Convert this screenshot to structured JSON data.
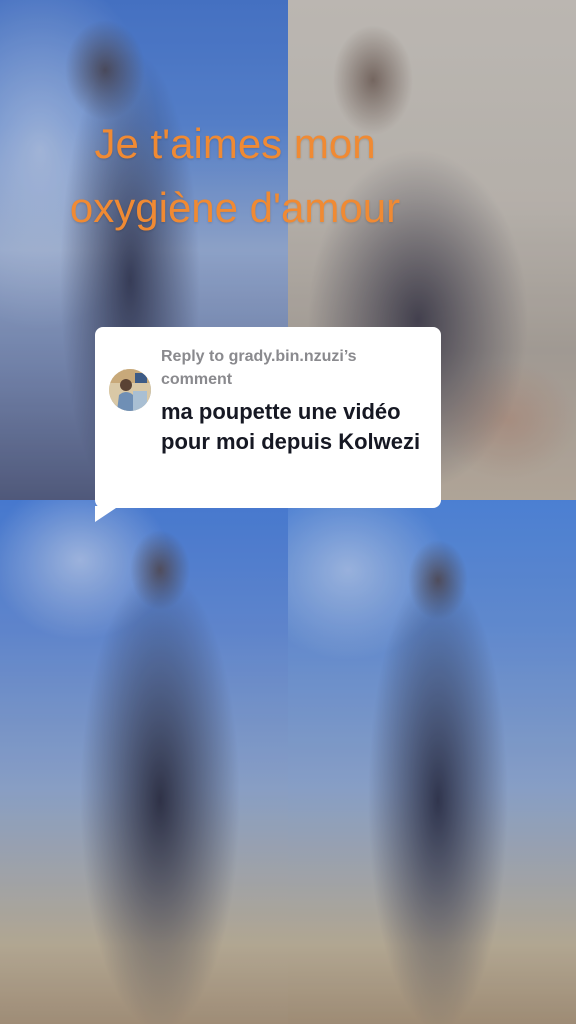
{
  "video": {
    "caption_lines": [
      "Je t'aimes mon",
      "oxygiène d'amour"
    ],
    "caption_color": "#f08a33"
  },
  "reply": {
    "prefix": "Reply to ",
    "username": "grady.bin.nzuzi",
    "suffix": "’s comment",
    "comment_text": "ma poupette une vidéo pour moi depuis Kolwezi",
    "avatar_icon": "user-avatar"
  }
}
